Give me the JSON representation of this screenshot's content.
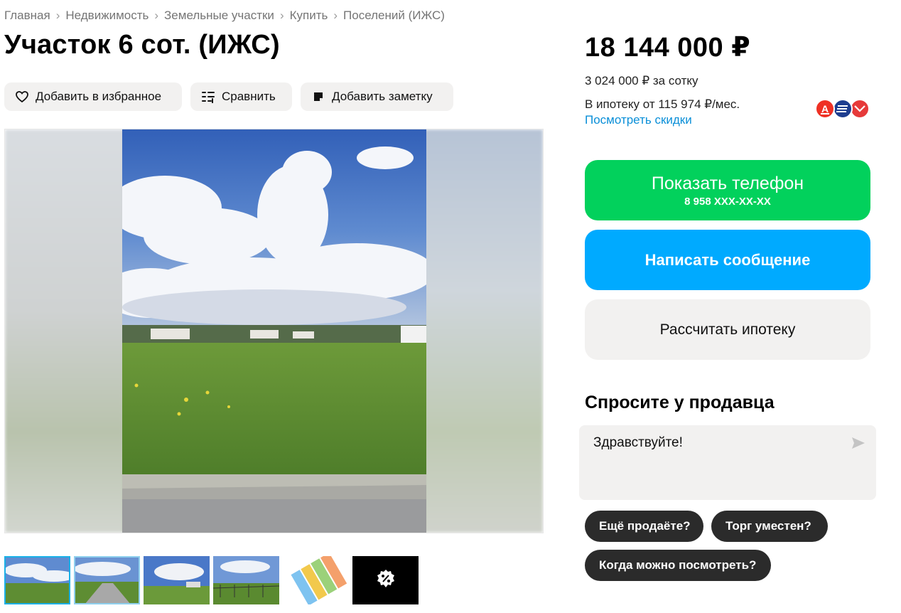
{
  "breadcrumb": [
    "Главная",
    "Недвижимость",
    "Земельные участки",
    "Купить",
    "Поселений (ИЖС)"
  ],
  "listing": {
    "title": "Участок 6 сот. (ИЖС)",
    "price": "18 144 000 ₽",
    "price_per_sotka": "3 024 000 ₽ за сотку",
    "mortgage_text": "В ипотеку от 115 974 ₽/мес.",
    "discounts_link": "Посмотреть скидки"
  },
  "actions": {
    "favorite": "Добавить в избранное",
    "compare": "Сравнить",
    "note": "Добавить заметку"
  },
  "contact": {
    "show_phone": "Показать телефон",
    "phone_masked": "8 958 XXX-XX-XX",
    "write_message": "Написать сообщение",
    "calc_mortgage": "Рассчитать ипотеку"
  },
  "ask": {
    "title": "Спросите у продавца",
    "message": "Здравствуйте!",
    "chips": [
      "Ещё продаёте?",
      "Торг уместен?",
      "Когда можно посмотреть?"
    ]
  },
  "bank_logos": [
    "alfa-bank-icon",
    "vtb-icon",
    "sovcombank-icon"
  ],
  "thumbnails": [
    "field-photo",
    "road-photo",
    "field-houses-photo",
    "fence-photo",
    "site-plan",
    "discount-badge"
  ],
  "colors": {
    "green_button": "#02d15c",
    "blue_button": "#00aaff",
    "link": "#0a8fd8",
    "chip_bg": "#2b2b2b",
    "light_bg": "#f2f1f0"
  }
}
